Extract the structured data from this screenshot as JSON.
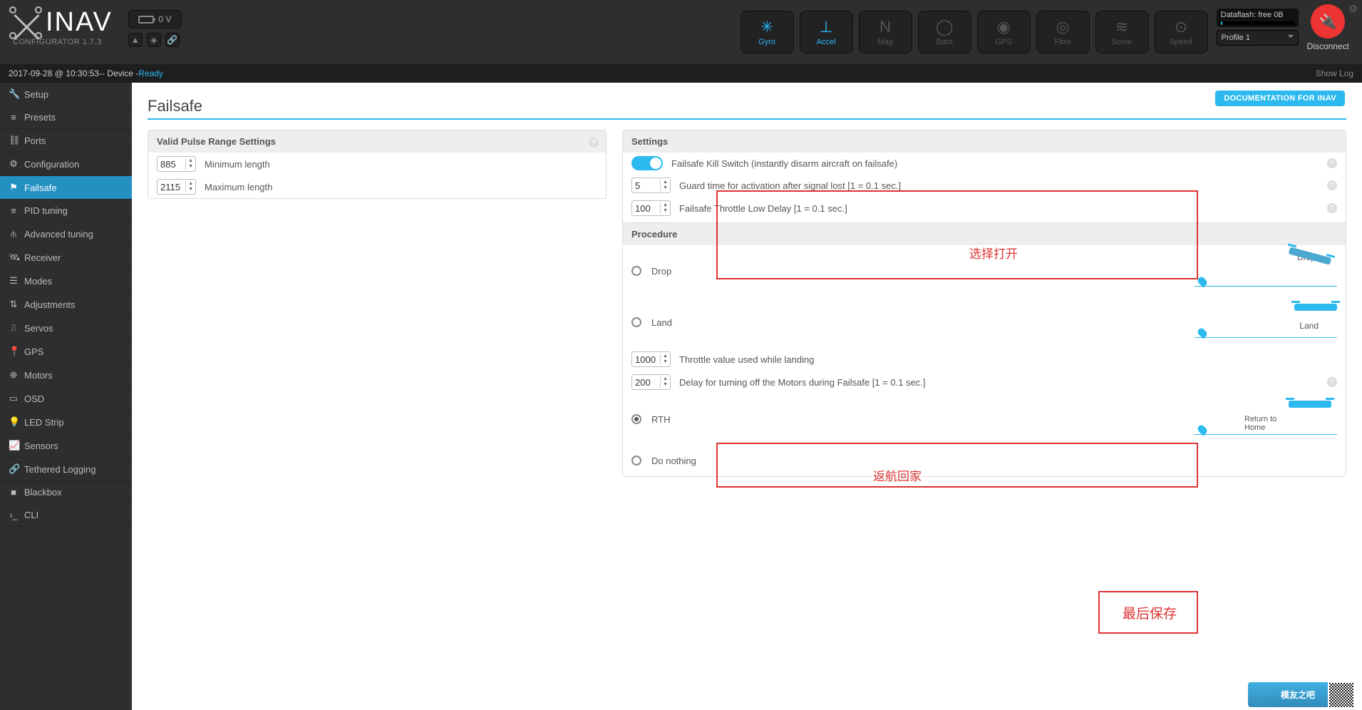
{
  "app": {
    "logo_text": "INAV",
    "subtitle": "CONFIGURATOR  1.7.3"
  },
  "topbar": {
    "battery": "0 V",
    "sensors": [
      {
        "glyph": "✳",
        "label": "Gyro",
        "active": true
      },
      {
        "glyph": "⊥",
        "label": "Accel",
        "active": true
      },
      {
        "glyph": "N",
        "label": "Mag"
      },
      {
        "glyph": "◯",
        "label": "Baro"
      },
      {
        "glyph": "◉",
        "label": "GPS"
      },
      {
        "glyph": "◎",
        "label": "Flow"
      },
      {
        "glyph": "≋",
        "label": "Sonar"
      },
      {
        "glyph": "⊙",
        "label": "Speed"
      }
    ],
    "dataflash": "Dataflash: free 0B",
    "profile": "Profile 1",
    "disconnect": "Disconnect"
  },
  "log": {
    "ts": "2017-09-28 @ 10:30:53",
    "dev": " -- Device - ",
    "status": "Ready",
    "right": "Show Log"
  },
  "sidebar": [
    {
      "icon": "🔧",
      "label": "Setup"
    },
    {
      "icon": "≡",
      "label": "Presets"
    },
    {
      "icon": "⛓",
      "label": "Ports"
    },
    {
      "icon": "⚙",
      "label": "Configuration"
    },
    {
      "icon": "⚑",
      "label": "Failsafe",
      "active": true
    },
    {
      "icon": "≡",
      "label": "PID tuning"
    },
    {
      "icon": "⫛",
      "label": "Advanced tuning"
    },
    {
      "icon": "🛰",
      "label": "Receiver"
    },
    {
      "icon": "☰",
      "label": "Modes"
    },
    {
      "icon": "⇅",
      "label": "Adjustments"
    },
    {
      "icon": "⎍",
      "label": "Servos"
    },
    {
      "icon": "📍",
      "label": "GPS"
    },
    {
      "icon": "⊕",
      "label": "Motors"
    },
    {
      "icon": "▭",
      "label": "OSD"
    },
    {
      "icon": "💡",
      "label": "LED Strip"
    },
    {
      "icon": "📈",
      "label": "Sensors"
    },
    {
      "icon": "🔗",
      "label": "Tethered Logging"
    },
    {
      "icon": "■",
      "label": "Blackbox"
    },
    {
      "icon": "›_",
      "label": "CLI"
    }
  ],
  "page": {
    "title": "Failsafe",
    "doc_btn": "DOCUMENTATION FOR INAV",
    "pulse": {
      "heading": "Valid Pulse Range Settings",
      "min_val": "885",
      "min_label": "Minimum length",
      "max_val": "2115",
      "max_label": "Maximum length"
    },
    "settings": {
      "heading": "Settings",
      "kill_label": "Failsafe Kill Switch (instantly disarm aircraft on failsafe)",
      "guard_val": "5",
      "guard_label": "Guard time for activation after signal lost [1 = 0.1 sec.]",
      "thrlow_val": "100",
      "thrlow_label": "Failsafe Throttle Low Delay [1 = 0.1 sec.]"
    },
    "procedure": {
      "heading": "Procedure",
      "drop": "Drop",
      "land": "Land",
      "throttle_val": "1000",
      "throttle_label": "Throttle value used while landing",
      "offdelay_val": "200",
      "offdelay_label": "Delay for turning off the Motors during Failsafe [1 = 0.1 sec.]",
      "rth": "RTH",
      "rth_media": "Return to Home",
      "donothing": "Do nothing"
    }
  },
  "annot": {
    "a1": "选择打开",
    "a2": "返航回家",
    "a3": "最后保存"
  },
  "watermark": "模友之吧"
}
